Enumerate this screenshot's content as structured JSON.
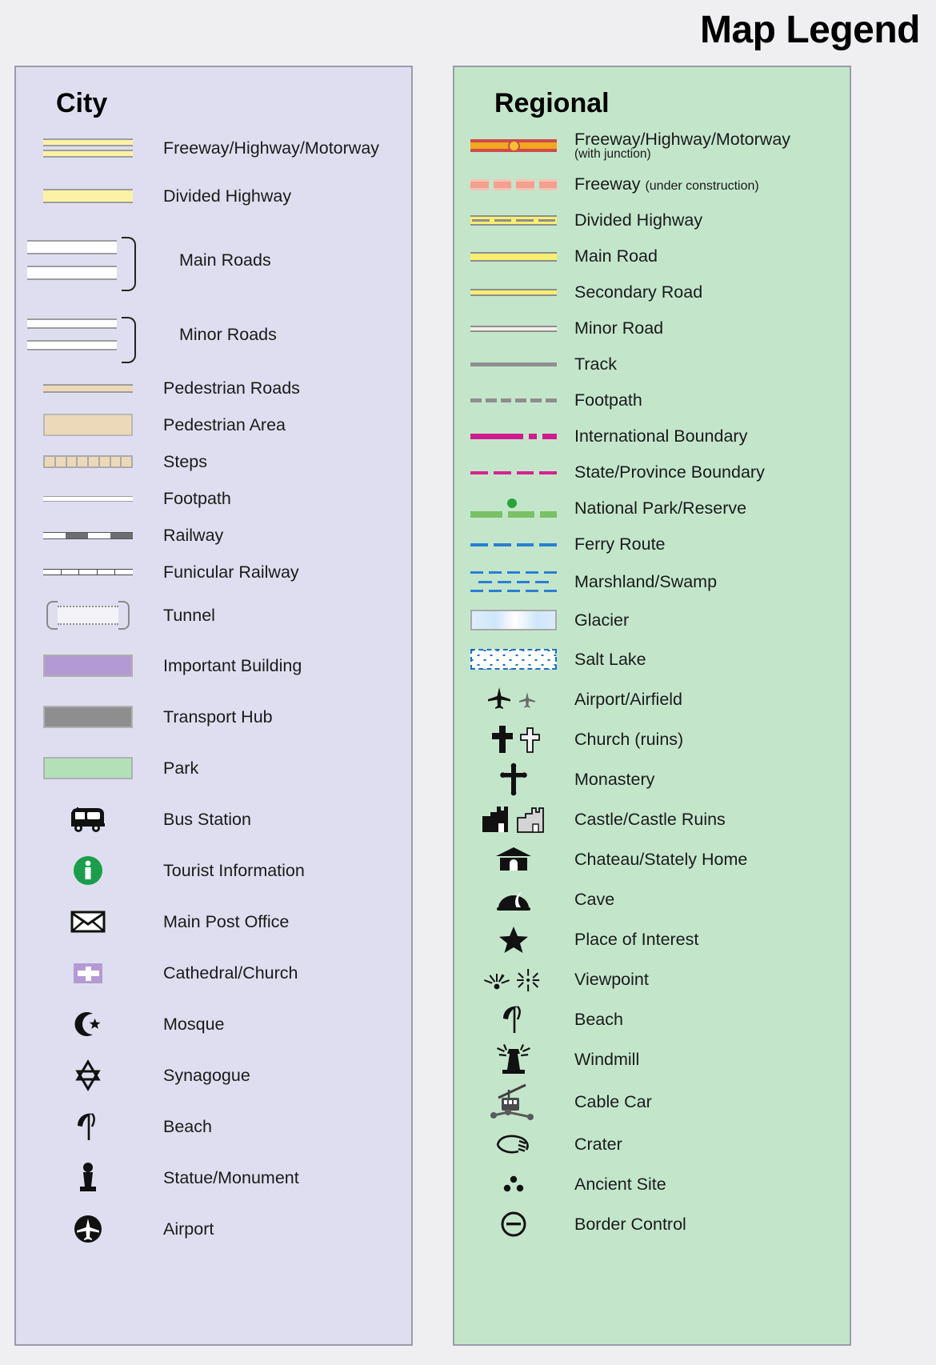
{
  "title": "Map Legend",
  "panels": {
    "city": {
      "heading": "City",
      "bg_color": "#dedef0",
      "items": [
        {
          "label": "Freeway/Highway/Motorway",
          "symbol": "freeway-city"
        },
        {
          "label": "Divided Highway",
          "symbol": "divided-highway-city"
        },
        {
          "label": "Main Roads",
          "symbol": "main-roads-city"
        },
        {
          "label": "Minor Roads",
          "symbol": "minor-roads-city"
        },
        {
          "label": "Pedestrian Roads",
          "symbol": "pedestrian-roads"
        },
        {
          "label": "Pedestrian Area",
          "symbol": "pedestrian-area"
        },
        {
          "label": "Steps",
          "symbol": "steps"
        },
        {
          "label": "Footpath",
          "symbol": "footpath-city"
        },
        {
          "label": "Railway",
          "symbol": "railway"
        },
        {
          "label": "Funicular Railway",
          "symbol": "funicular-railway"
        },
        {
          "label": "Tunnel",
          "symbol": "tunnel"
        },
        {
          "label": "Important Building",
          "symbol": "important-building"
        },
        {
          "label": "Transport Hub",
          "symbol": "transport-hub"
        },
        {
          "label": "Park",
          "symbol": "park"
        },
        {
          "label": "Bus Station",
          "symbol": "bus-icon"
        },
        {
          "label": "Tourist Information",
          "symbol": "information-icon"
        },
        {
          "label": "Main Post Office",
          "symbol": "envelope-icon"
        },
        {
          "label": "Cathedral/Church",
          "symbol": "cathedral-icon"
        },
        {
          "label": "Mosque",
          "symbol": "crescent-star-icon"
        },
        {
          "label": "Synagogue",
          "symbol": "star-of-david-icon"
        },
        {
          "label": "Beach",
          "symbol": "parasol-icon"
        },
        {
          "label": "Statue/Monument",
          "symbol": "statue-icon"
        },
        {
          "label": "Airport",
          "symbol": "airport-circle-icon"
        }
      ],
      "colors": {
        "freeway": "#fbf2a6",
        "divided_highway": "#fbf2a6",
        "main_road": "#ffffff",
        "minor_road": "#ffffff",
        "pedestrian": "#ecd9b9",
        "important_building": "#b49ad4",
        "transport_hub": "#8e8e8e",
        "park": "#b4e0b8",
        "tourist_info": "#1a9e4b",
        "cathedral": "#b49ad4"
      }
    },
    "regional": {
      "heading": "Regional",
      "bg_color": "#c3e6ca",
      "items": [
        {
          "label": "Freeway/Highway/Motorway",
          "sublabel": "(with junction)",
          "symbol": "freeway-junction"
        },
        {
          "label": "Freeway",
          "annotation": "(under construction)",
          "symbol": "freeway-under-construction"
        },
        {
          "label": "Divided Highway",
          "symbol": "divided-highway-regional"
        },
        {
          "label": "Main Road",
          "symbol": "main-road-regional"
        },
        {
          "label": "Secondary Road",
          "symbol": "secondary-road"
        },
        {
          "label": "Minor Road",
          "symbol": "minor-road-regional"
        },
        {
          "label": "Track",
          "symbol": "track"
        },
        {
          "label": "Footpath",
          "symbol": "footpath-regional"
        },
        {
          "label": "International Boundary",
          "symbol": "international-boundary"
        },
        {
          "label": "State/Province Boundary",
          "symbol": "state-boundary"
        },
        {
          "label": "National Park/Reserve",
          "symbol": "national-park"
        },
        {
          "label": "Ferry Route",
          "symbol": "ferry-route"
        },
        {
          "label": "Marshland/Swamp",
          "symbol": "marshland"
        },
        {
          "label": "Glacier",
          "symbol": "glacier"
        },
        {
          "label": "Salt Lake",
          "symbol": "salt-lake"
        },
        {
          "label": "Airport/Airfield",
          "symbol": "airplane-icon"
        },
        {
          "label": "Church (ruins)",
          "symbol": "cross-icon"
        },
        {
          "label": "Monastery",
          "symbol": "monastery-cross-icon"
        },
        {
          "label": "Castle/Castle Ruins",
          "symbol": "castle-icon"
        },
        {
          "label": "Chateau/Stately Home",
          "symbol": "chateau-icon"
        },
        {
          "label": "Cave",
          "symbol": "cave-icon"
        },
        {
          "label": "Place of Interest",
          "symbol": "star-icon"
        },
        {
          "label": "Viewpoint",
          "symbol": "viewpoint-icon"
        },
        {
          "label": "Beach",
          "symbol": "parasol-icon"
        },
        {
          "label": "Windmill",
          "symbol": "windmill-icon"
        },
        {
          "label": "Cable Car",
          "symbol": "cable-car-icon"
        },
        {
          "label": "Crater",
          "symbol": "crater-icon"
        },
        {
          "label": "Ancient Site",
          "symbol": "ancient-site-icon"
        },
        {
          "label": "Border Control",
          "symbol": "border-control-icon"
        }
      ],
      "colors": {
        "freeway_casing": "#cf4a4a",
        "freeway_core": "#f0a81e",
        "junction": "#f2c230",
        "under_construction": "#f5a08f",
        "road_yellow": "#f7ef72",
        "road_casing": "#8e8e8e",
        "international_boundary": "#cf1b8f",
        "state_boundary": "#d8228f",
        "national_park": "#79c165",
        "national_park_dot": "#2aa33e",
        "water_blue": "#2a7fd4",
        "salt_lake_border": "#1f6fc4"
      }
    }
  }
}
